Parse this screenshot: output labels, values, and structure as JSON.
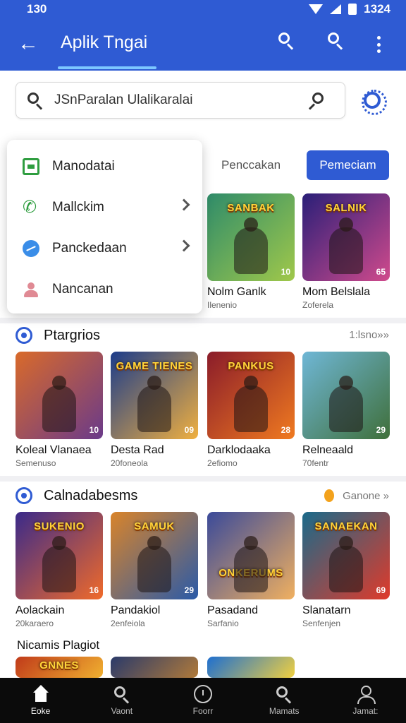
{
  "status": {
    "time": "130",
    "clock": "1324"
  },
  "app_bar": {
    "title": "Aplik Tngai"
  },
  "search": {
    "value": "JSnParalan Ulalikaralai"
  },
  "tabs": {
    "plain": "Penccakan",
    "primary": "Pemeciam"
  },
  "menu": {
    "items": [
      {
        "label": "Manodatai",
        "icon": "card-icon"
      },
      {
        "label": "Mallckim",
        "icon": "phone-icon"
      },
      {
        "label": "Panckedaan",
        "icon": "messenger-icon"
      },
      {
        "label": "Nancanan",
        "icon": "user-icon"
      }
    ]
  },
  "top_row": [
    {
      "logo": "SANBAK",
      "badge": "10",
      "title": "Nolm Ganlk",
      "sub": "Ilenenio",
      "colors": [
        "#2f8c6a",
        "#a0c84a"
      ]
    },
    {
      "logo": "SALNIK",
      "badge": "65",
      "title": "Mom Belslala",
      "sub": "Zoferela",
      "colors": [
        "#2a1f78",
        "#d04a8c"
      ]
    }
  ],
  "section1": {
    "title": "Ptargrios",
    "see_all": "1:lsno»»",
    "cards": [
      {
        "logo": "",
        "badge": "10",
        "title": "Koleal Vlanaea",
        "sub": "Semenuso",
        "colors": [
          "#d96a2a",
          "#6a3a8a"
        ]
      },
      {
        "logo": "GAME TIENES",
        "badge": "09",
        "title": "Desta Rad",
        "sub": "20foneola",
        "colors": [
          "#1c3c8a",
          "#f0b040"
        ]
      },
      {
        "logo": "PANKUS",
        "badge": "28",
        "title": "Darklodaaka",
        "sub": "2efiomo",
        "colors": [
          "#8a1c2a",
          "#f07a20"
        ]
      },
      {
        "logo": "",
        "badge": "29",
        "title": "Relneaald",
        "sub": "70fentr",
        "colors": [
          "#6fb7d6",
          "#3f6f3a"
        ]
      }
    ]
  },
  "section2": {
    "title": "Calnadabesms",
    "see_all": "Ganone »",
    "cards": [
      {
        "logo": "SUKENIO",
        "badge": "16",
        "title": "Aolackain",
        "sub": "20karaero",
        "colors": [
          "#3a2a8a",
          "#f06a2a"
        ]
      },
      {
        "logo": "SAMUK",
        "badge": "29",
        "title": "Pandakiol",
        "sub": "2enfeiola",
        "colors": [
          "#d9842a",
          "#2a5aa8"
        ]
      },
      {
        "logo": "ONKERUMS",
        "badge": "",
        "title": "Pasadand",
        "sub": "Sarfanio",
        "colors": [
          "#3a4a9a",
          "#f0b060"
        ]
      },
      {
        "logo": "SANAEKAN",
        "badge": "69",
        "title": "Slanatarn",
        "sub": "Senfenjen",
        "colors": [
          "#1a6a8a",
          "#e03a2a"
        ]
      }
    ]
  },
  "section3": {
    "title": "Nicamis Plagiot",
    "cards": [
      {
        "logo": "GNNES",
        "colors": [
          "#c03a1a",
          "#f0b030"
        ]
      },
      {
        "logo": "",
        "colors": [
          "#2a3a6a",
          "#b07a3a"
        ]
      },
      {
        "logo": "",
        "colors": [
          "#1e6fd0",
          "#f0d040"
        ]
      }
    ]
  },
  "bottom_nav": {
    "items": [
      {
        "label": "Eoke",
        "icon": "home-icon"
      },
      {
        "label": "Vaont",
        "icon": "search-icon"
      },
      {
        "label": "Foorr",
        "icon": "clock-icon"
      },
      {
        "label": "Mamats",
        "icon": "search-icon"
      },
      {
        "label": "Jamat:",
        "icon": "profile-icon"
      }
    ]
  }
}
